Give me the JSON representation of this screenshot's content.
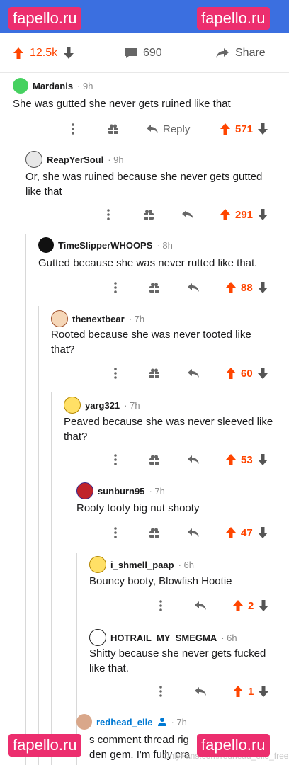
{
  "header": {
    "title": "..."
  },
  "watermarks": [
    "fapello.ru",
    "fapello.ru",
    "fapello.ru",
    "fapello.ru"
  ],
  "post": {
    "votes": "12.5k",
    "comments": "690",
    "share_label": "Share"
  },
  "comments": [
    {
      "author": "Mardanis",
      "time": "· 9h",
      "body": "She was gutted she never gets ruined like that",
      "score": "571",
      "reply_label": "Reply"
    },
    {
      "author": "ReapYerSoul",
      "time": "· 9h",
      "body": "Or, she was ruined because she never gets gutted like that",
      "score": "291"
    },
    {
      "author": "TimeSlipperWHOOPS",
      "time": "· 8h",
      "body": "Gutted because she was never rutted like that.",
      "score": "88"
    },
    {
      "author": "thenextbear",
      "time": "· 7h",
      "body": "Rooted because she was never tooted like that?",
      "score": "60"
    },
    {
      "author": "yarg321",
      "time": "· 7h",
      "body": "Peaved because she was never sleeved like that?",
      "score": "53"
    },
    {
      "author": "sunburn95",
      "time": "· 7h",
      "body": "Rooty tooty big nut shooty",
      "score": "47"
    },
    {
      "author": "i_shmell_paap",
      "time": "· 6h",
      "body": "Bouncy booty, Blowfish Hootie",
      "score": "2"
    },
    {
      "author": "HOTRAIL_MY_SMEGMA",
      "time": "· 6h",
      "body": "Shitty because she never gets fucked like that.",
      "score": "1"
    },
    {
      "author": "redhead_elle",
      "time": "· 7h",
      "body_line1": "s comment thread rig",
      "body_line2": "den gem. I'm fully cra"
    }
  ],
  "footer_text": "OnlyFans.com/redhead_elle_free",
  "colors": {
    "upvote": "#ff4500",
    "author_highlight": "#0079d3",
    "topbar": "#3b6fe0",
    "watermark": "#ec2e6e"
  }
}
